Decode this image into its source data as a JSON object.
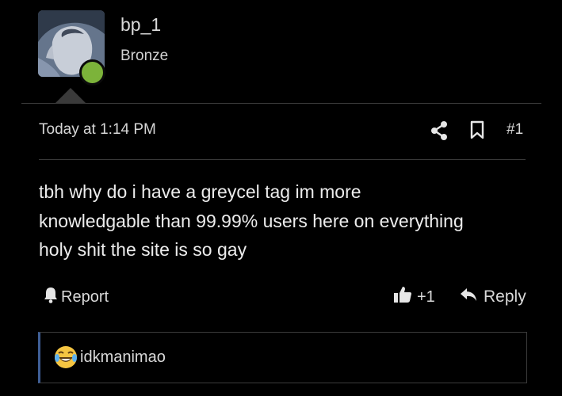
{
  "user": {
    "name": "bp_1",
    "rank": "Bronze",
    "online_color": "#7cb33a"
  },
  "post": {
    "timestamp": "Today at 1:14 PM",
    "number": "#1",
    "message": "tbh why do i have a greycel tag im more\nknowledgable than 99.99% users here on everything\nholy shit the site is so gay",
    "share_icon": "share-icon",
    "bookmark_icon": "bookmark-icon"
  },
  "actions": {
    "report_label": "Report",
    "report_icon": "bell-icon",
    "like_count": "+1",
    "like_icon": "thumbs-up-icon",
    "reply_label": "Reply",
    "reply_icon": "reply-arrow-icon"
  },
  "reactions": {
    "emoji_icon": "laughing-tears-emoji-icon",
    "user": "idkmanimao",
    "accent_color": "#3f5f96"
  }
}
